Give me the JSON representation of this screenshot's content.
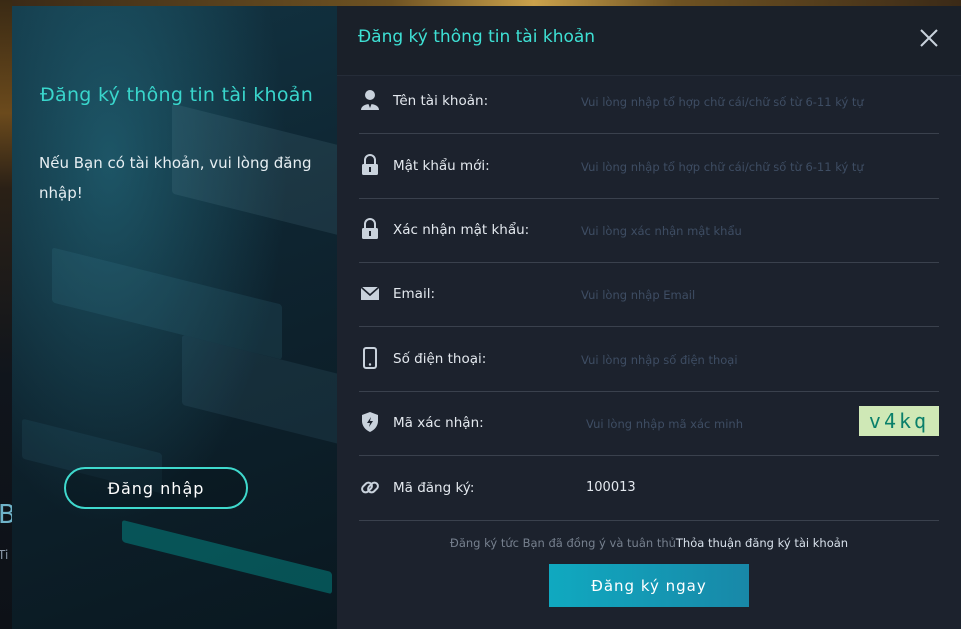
{
  "background": {
    "peek_letter": "B",
    "peek_text": "Ti"
  },
  "left_panel": {
    "title": "Đăng ký thông tin tài khoản",
    "text": "Nếu Bạn có tài khoản, vui lòng đăng nhập!",
    "login_button": "Đăng nhập"
  },
  "form": {
    "header_title": "Đăng ký thông tin tài khoản",
    "fields": [
      {
        "label": "Tên tài khoản:",
        "placeholder": "Vui lòng nhập tổ hợp chữ cái/chữ số từ 6-11 ký tự",
        "icon": "user-icon"
      },
      {
        "label": "Mật khẩu mới:",
        "placeholder": "Vui lòng nhập tổ hợp chữ cái/chữ số từ 6-11 ký tự",
        "icon": "lock-icon"
      },
      {
        "label": "Xác nhận mật khẩu:",
        "placeholder": "Vui lòng xác nhận mật khẩu",
        "icon": "lock-icon"
      },
      {
        "label": "Email:",
        "placeholder": "Vui lòng nhập Email",
        "icon": "mail-icon"
      },
      {
        "label": "Số điện thoại:",
        "placeholder": "Vui lòng nhập số điện thoại",
        "icon": "phone-icon"
      },
      {
        "label": "Mã xác nhận:",
        "placeholder": "Vui lòng nhập mã xác minh",
        "icon": "shield-icon",
        "captcha": "v4kq"
      },
      {
        "label": "Mã đăng ký:",
        "value": "100013",
        "icon": "link-icon"
      }
    ],
    "terms_text": "Đăng ký tức Bạn đã đồng ý và tuân thủ",
    "terms_link": "Thỏa thuận đăng ký tài khoản",
    "submit_button": "Đăng ký ngay"
  },
  "colors": {
    "accent": "#3ee0d4",
    "button": "#138fb0",
    "panel": "#1c222d"
  }
}
